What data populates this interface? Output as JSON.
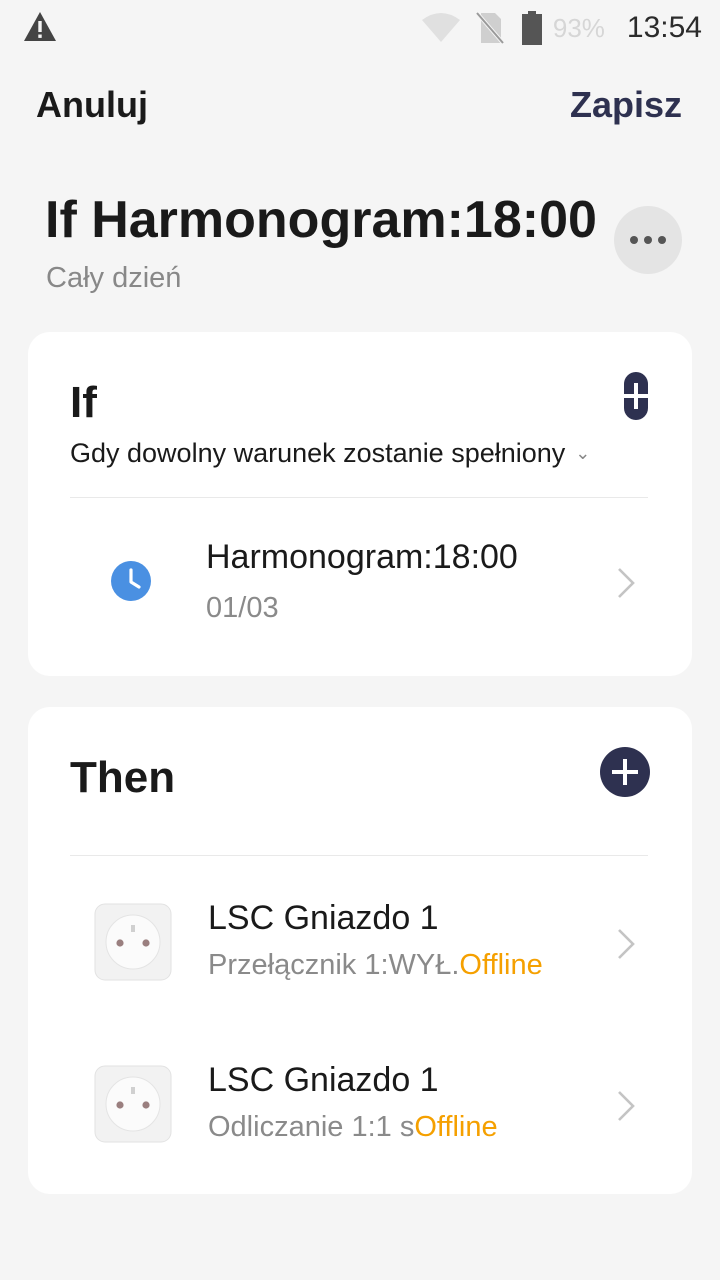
{
  "status_bar": {
    "battery_pct": "93%",
    "time": "13:54",
    "icons": [
      "warning-icon",
      "wifi-icon",
      "no-sim-icon",
      "battery-icon"
    ]
  },
  "action_bar": {
    "cancel_label": "Anuluj",
    "save_label": "Zapisz"
  },
  "header": {
    "title": "If Harmonogram:18:00",
    "subtitle": "Cały dzień"
  },
  "if_section": {
    "heading": "If",
    "condition_mode": "Gdy dowolny warunek zostanie spełniony",
    "items": [
      {
        "title": "Harmonogram:18:00",
        "subtitle": "01/03",
        "icon": "clock-icon"
      }
    ]
  },
  "then_section": {
    "heading": "Then",
    "items": [
      {
        "title": "LSC Gniazdo 1",
        "subtitle": "Przełącznik 1:WYŁ.",
        "status": "Offline",
        "icon": "smart-plug-icon"
      },
      {
        "title": "LSC Gniazdo 1",
        "subtitle": "Odliczanie 1:1 s",
        "status": "Offline",
        "icon": "smart-plug-icon"
      }
    ]
  },
  "colors": {
    "accent": "#2e3150",
    "offline": "#f5a000",
    "clock": "#4a90e2",
    "background": "#f5f5f5"
  }
}
